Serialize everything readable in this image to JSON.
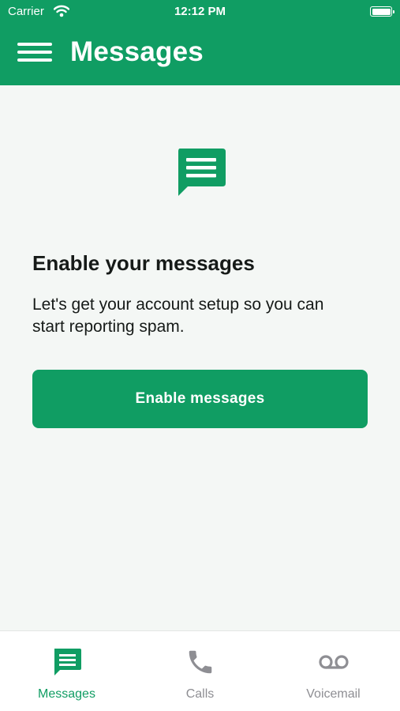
{
  "status_bar": {
    "carrier": "Carrier",
    "time": "12:12 PM"
  },
  "nav": {
    "title": "Messages"
  },
  "content": {
    "title": "Enable your messages",
    "description": "Let's get your account setup so you can start reporting spam.",
    "button_label": "Enable messages"
  },
  "tabs": [
    {
      "label": "Messages",
      "icon": "message-icon",
      "active": true
    },
    {
      "label": "Calls",
      "icon": "phone-icon",
      "active": false
    },
    {
      "label": "Voicemail",
      "icon": "voicemail-icon",
      "active": false
    }
  ],
  "colors": {
    "brand_green": "#109d63",
    "background": "#f4f7f5",
    "text_dark": "#161a18",
    "tab_inactive": "#8e8e93"
  }
}
